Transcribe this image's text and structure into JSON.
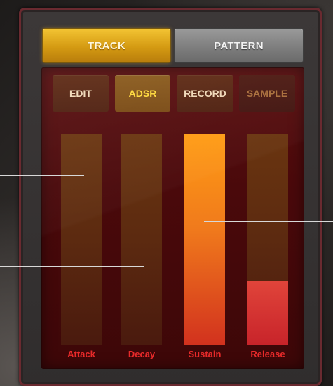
{
  "top_tabs": [
    {
      "label": "TRACK",
      "active": true
    },
    {
      "label": "PATTERN",
      "active": false
    }
  ],
  "sub_tabs": [
    {
      "label": "EDIT",
      "state": "normal"
    },
    {
      "label": "ADSR",
      "state": "active"
    },
    {
      "label": "RECORD",
      "state": "normal"
    },
    {
      "label": "SAMPLE",
      "state": "dim"
    }
  ],
  "sliders": [
    {
      "label": "Attack",
      "level": 0.0
    },
    {
      "label": "Decay",
      "level": 0.0
    },
    {
      "label": "Sustain",
      "level": 1.0
    },
    {
      "label": "Release",
      "level": 0.3
    }
  ],
  "colors": {
    "active_tab": "#e0aa1e",
    "inactive_tab": "#7e7e7e",
    "panel": "#4a090b",
    "label_red": "#e82a2a",
    "active_subtab_text": "#ffd93a"
  }
}
